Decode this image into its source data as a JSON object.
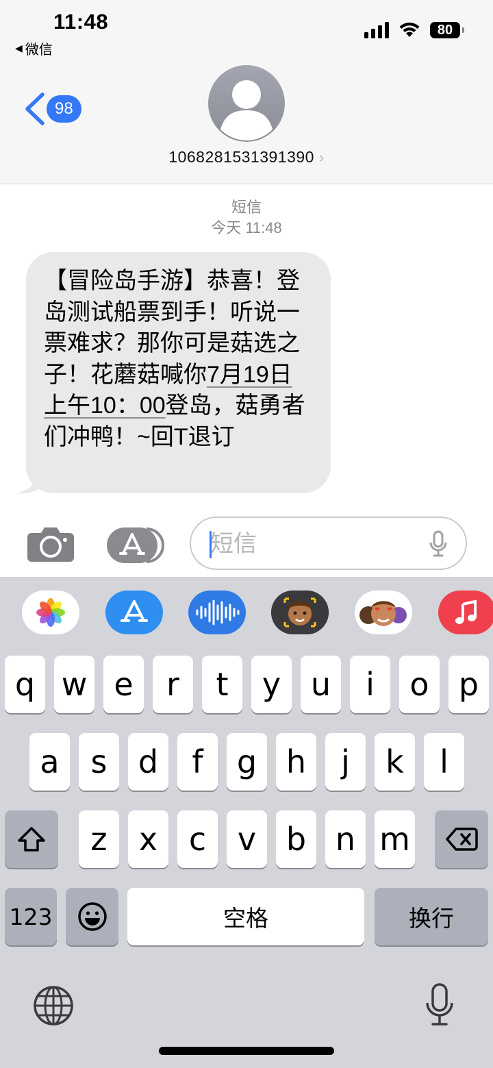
{
  "status_bar": {
    "time": "11:48",
    "back_app": "微信",
    "battery": "80",
    "icons": [
      "cellular-signal-icon",
      "wifi-icon",
      "battery-icon"
    ]
  },
  "nav": {
    "unread_count": "98",
    "contact_number": "1068281531391390",
    "chevron": "›"
  },
  "conversation": {
    "service": "短信",
    "timestamp": "今天 11:48",
    "message": {
      "before_link": "【冒险岛手游】恭喜！登岛测试船票到手！听说一票难求？那你可是菇选之子！花蘑菇喊你",
      "link": "7月19日上午10：00",
      "after_link": "登岛，菇勇者们冲鸭！~回T退订"
    }
  },
  "compose": {
    "placeholder": "短信"
  },
  "keyboard": {
    "apps": [
      "photos-app-icon",
      "app-store-app-icon",
      "audio-message-app-icon",
      "memoji-camera-app-icon",
      "memoji-stickers-app-icon",
      "music-app-icon"
    ],
    "row1": [
      "q",
      "w",
      "e",
      "r",
      "t",
      "y",
      "u",
      "i",
      "o",
      "p"
    ],
    "row2": [
      "a",
      "s",
      "d",
      "f",
      "g",
      "h",
      "j",
      "k",
      "l"
    ],
    "row3": [
      "z",
      "x",
      "c",
      "v",
      "b",
      "n",
      "m"
    ],
    "numbers_label": "123",
    "space_label": "空格",
    "return_label": "换行",
    "colors": {
      "accent": "#3478f6",
      "keyboard_bg": "#d3d5db",
      "bubble": "#e9e9eb"
    }
  }
}
